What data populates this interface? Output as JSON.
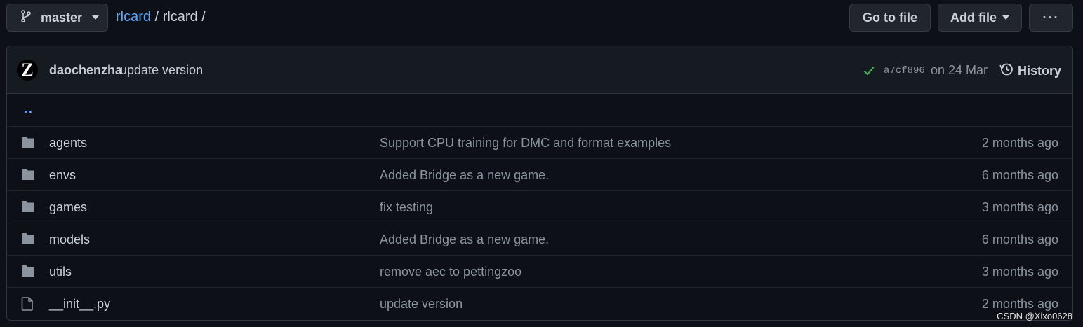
{
  "branch": {
    "name": "master",
    "icon": "git-branch-icon"
  },
  "breadcrumb": {
    "repo": "rlcard",
    "sep1": " / ",
    "folder": "rlcard",
    "sep2": " /"
  },
  "actions": {
    "goto_file": "Go to file",
    "add_file": "Add file",
    "more": "···"
  },
  "commit": {
    "avatar_letter": "Z",
    "author": "daochenzha",
    "message": "update version",
    "sha": "a7cf896",
    "date": "on 24 Mar",
    "history_label": "History",
    "status_color": "#3fb950"
  },
  "parent_dir": "..",
  "files": [
    {
      "type": "folder",
      "name": "agents",
      "message": "Support CPU training for DMC and format examples",
      "age": "2 months ago"
    },
    {
      "type": "folder",
      "name": "envs",
      "message": "Added Bridge as a new game.",
      "age": "6 months ago"
    },
    {
      "type": "folder",
      "name": "games",
      "message": "fix testing",
      "age": "3 months ago"
    },
    {
      "type": "folder",
      "name": "models",
      "message": "Added Bridge as a new game.",
      "age": "6 months ago"
    },
    {
      "type": "folder",
      "name": "utils",
      "message": "remove aec to pettingzoo",
      "age": "3 months ago"
    },
    {
      "type": "file",
      "name": "__init__.py",
      "message": "update version",
      "age": "2 months ago"
    }
  ],
  "watermark": "CSDN @Xixo0628",
  "colors": {
    "background": "#0d1117",
    "link": "#58a6ff",
    "muted": "#8b949e",
    "folder": "#8b949e"
  }
}
